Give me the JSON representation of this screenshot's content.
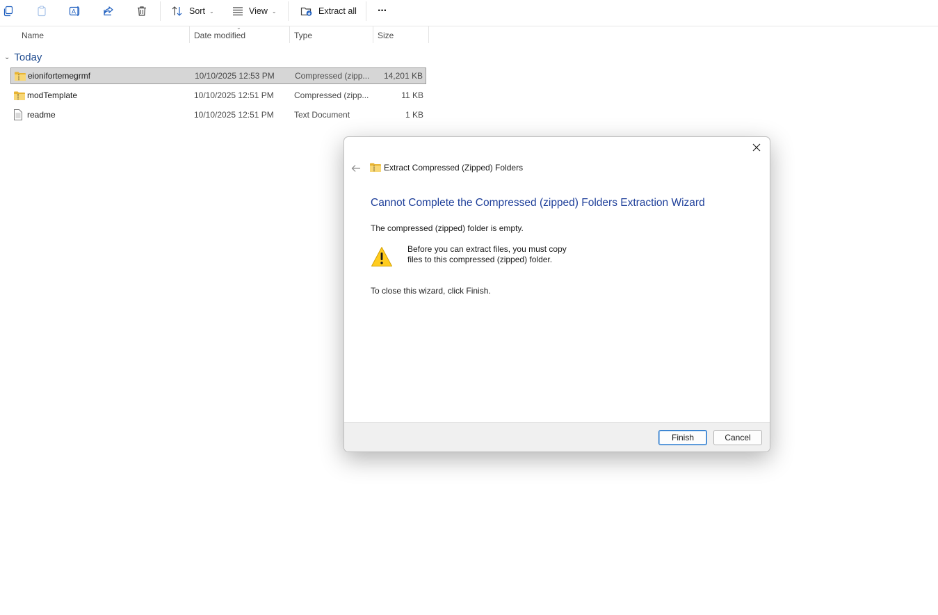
{
  "toolbar": {
    "icons": [
      "copy-icon",
      "paste-icon",
      "rename-icon",
      "share-icon",
      "delete-icon"
    ],
    "sort_label": "Sort",
    "view_label": "View",
    "extract_label": "Extract all",
    "more_label": "···"
  },
  "columns": {
    "name": "Name",
    "date": "Date modified",
    "type": "Type",
    "size": "Size"
  },
  "group": {
    "label": "Today"
  },
  "files": [
    {
      "name": "eionifortemegrmf",
      "date": "10/10/2025 12:53 PM",
      "type": "Compressed (zipp...",
      "size": "14,201 KB",
      "icon": "zip-folder-icon",
      "selected": true
    },
    {
      "name": "modTemplate",
      "date": "10/10/2025 12:51 PM",
      "type": "Compressed (zipp...",
      "size": "11 KB",
      "icon": "zip-folder-icon",
      "selected": false
    },
    {
      "name": "readme",
      "date": "10/10/2025 12:51 PM",
      "type": "Text Document",
      "size": "1 KB",
      "icon": "text-document-icon",
      "selected": false
    }
  ],
  "dialog": {
    "title": "Extract Compressed (Zipped) Folders",
    "heading": "Cannot Complete the Compressed (zipped) Folders Extraction Wizard",
    "message": "The compressed (zipped) folder is empty.",
    "warning_line1": "Before you can extract files, you must copy",
    "warning_line2": "files to this compressed (zipped) folder.",
    "instruction": "To close this wizard, click Finish.",
    "finish_label": "Finish",
    "cancel_label": "Cancel",
    "accent_color": "#1e3f9a"
  }
}
